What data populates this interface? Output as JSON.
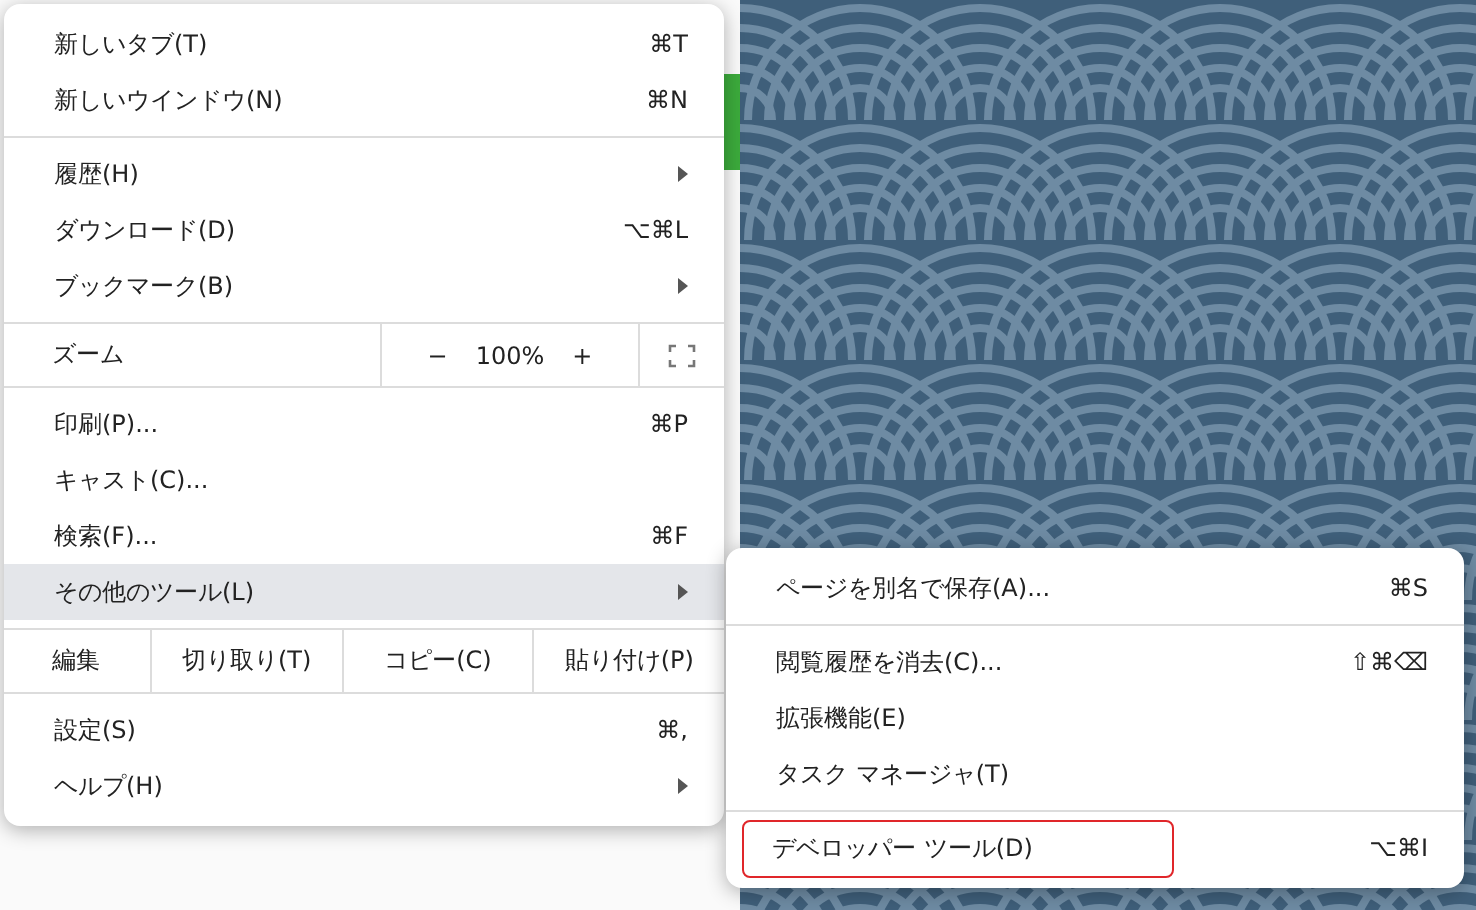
{
  "menu": {
    "sections": [
      {
        "kind": "items",
        "items": [
          {
            "label": "新しいタブ(T)",
            "shortcut": "⌘T",
            "submenu": false,
            "selected": false
          },
          {
            "label": "新しいウインドウ(N)",
            "shortcut": "⌘N",
            "submenu": false,
            "selected": false
          }
        ]
      },
      {
        "kind": "items",
        "items": [
          {
            "label": "履歴(H)",
            "submenu": true,
            "selected": false
          },
          {
            "label": "ダウンロード(D)",
            "shortcut": "⌥⌘L",
            "submenu": false,
            "selected": false
          },
          {
            "label": "ブックマーク(B)",
            "submenu": true,
            "selected": false
          }
        ]
      },
      {
        "kind": "zoom",
        "label": "ズーム",
        "minus": "−",
        "value": "100%",
        "plus": "+"
      },
      {
        "kind": "items",
        "items": [
          {
            "label": "印刷(P)...",
            "shortcut": "⌘P",
            "submenu": false,
            "selected": false
          },
          {
            "label": "キャスト(C)...",
            "submenu": false,
            "selected": false
          },
          {
            "label": "検索(F)...",
            "shortcut": "⌘F",
            "submenu": false,
            "selected": false
          },
          {
            "label": "その他のツール(L)",
            "submenu": true,
            "selected": true
          }
        ]
      },
      {
        "kind": "edit",
        "label": "編集",
        "buttons": [
          "切り取り(T)",
          "コピー(C)",
          "貼り付け(P)"
        ]
      },
      {
        "kind": "items",
        "items": [
          {
            "label": "設定(S)",
            "shortcut": "⌘,",
            "submenu": false,
            "selected": false
          },
          {
            "label": "ヘルプ(H)",
            "submenu": true,
            "selected": false
          }
        ]
      }
    ]
  },
  "submenu": {
    "sections": [
      {
        "items": [
          {
            "label": "ページを別名で保存(A)...",
            "shortcut": "⌘S",
            "outlined": false
          }
        ]
      },
      {
        "items": [
          {
            "label": "閲覧履歴を消去(C)...",
            "shortcut": "⇧⌘⌫",
            "outlined": false
          },
          {
            "label": "拡張機能(E)",
            "outlined": false
          },
          {
            "label": "タスク マネージャ(T)",
            "outlined": false
          }
        ]
      },
      {
        "items": [
          {
            "label": "デベロッパー ツール(D)",
            "shortcut": "⌥⌘I",
            "outlined": true
          }
        ]
      }
    ]
  }
}
